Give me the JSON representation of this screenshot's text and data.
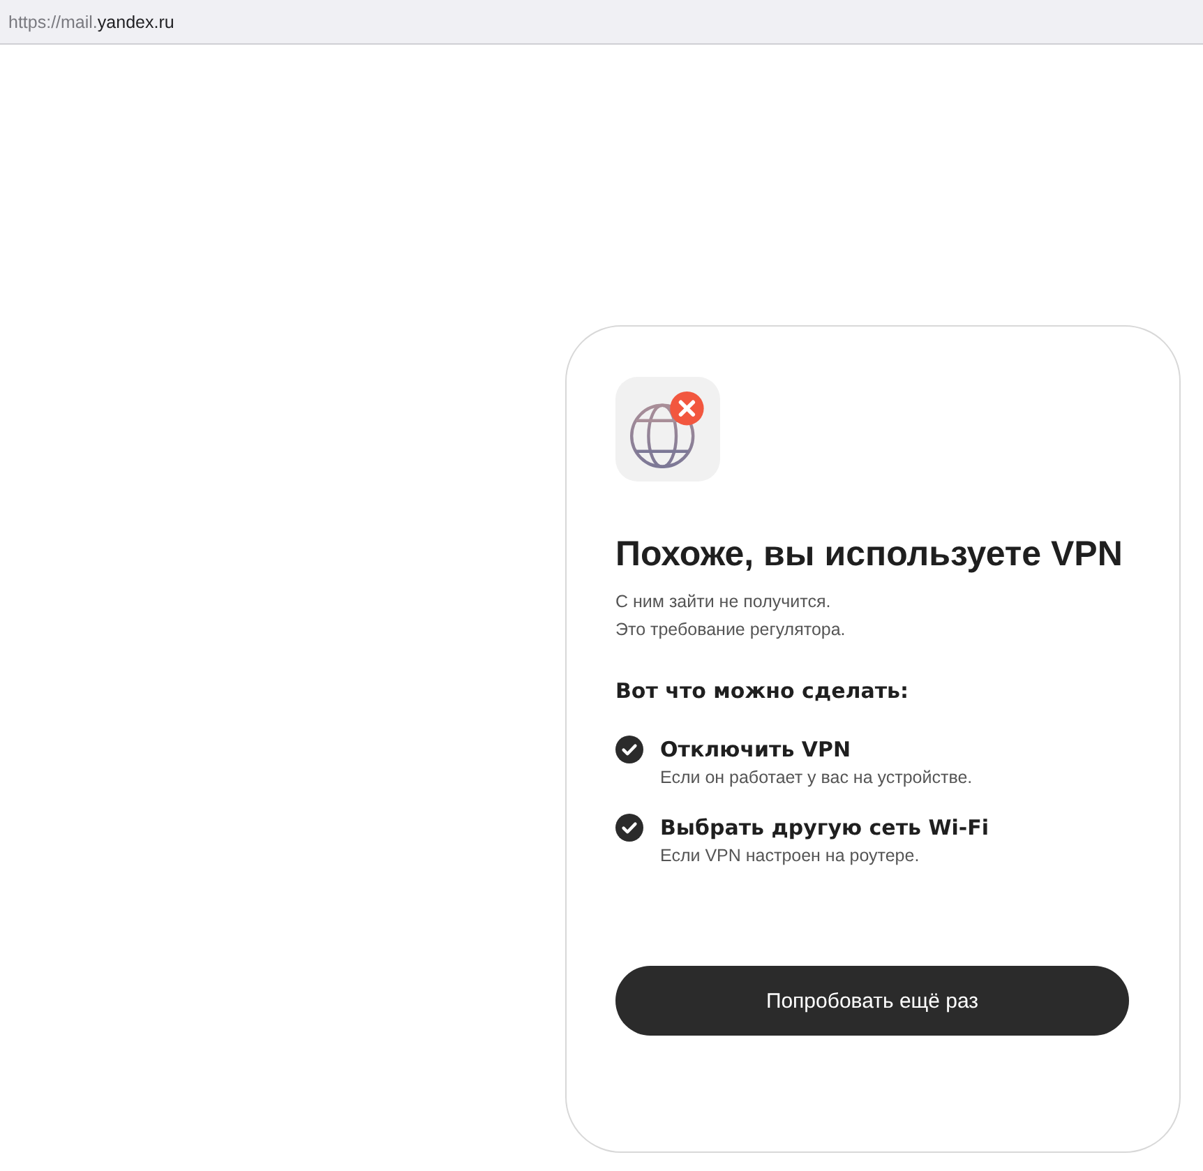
{
  "address_bar": {
    "url_prefix": "https://mail.",
    "url_host": "yandex.ru"
  },
  "card": {
    "title": "Похоже, вы используете VPN",
    "description": [
      "С ним зайти не получится.",
      "Это требование регулятора."
    ],
    "options_heading": "Вот что можно сделать:",
    "options": [
      {
        "title": "Отключить VPN",
        "hint": "Если он работает у вас на устройстве.",
        "checked": true
      },
      {
        "title": "Выбрать другую сеть Wi-Fi",
        "hint": "Если VPN настроен на роутере.",
        "checked": true
      }
    ],
    "button": "Попробовать ещё раз"
  }
}
